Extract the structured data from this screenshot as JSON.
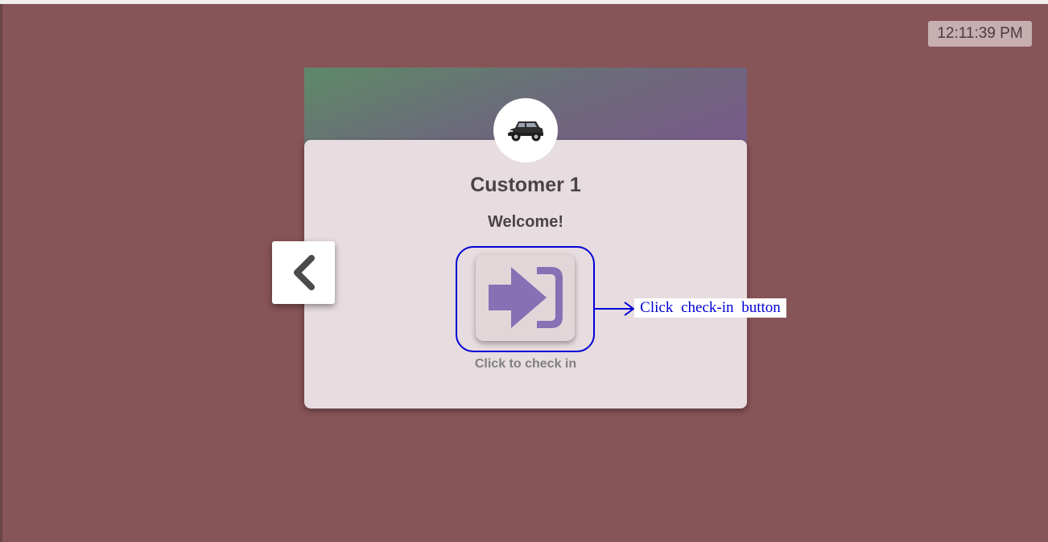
{
  "clock": {
    "time": "12:11:39 PM"
  },
  "customer": {
    "name": "Customer 1",
    "greeting": "Welcome!",
    "avatar_icon": "suv-car-icon"
  },
  "checkin": {
    "icon": "sign-in-arrow-icon",
    "caption": "Click to check in"
  },
  "navigation": {
    "prev_icon": "chevron-left-icon"
  },
  "annotation": {
    "label": "Click check-in button"
  },
  "colors": {
    "background": "#875457",
    "card": "#e7dcdf",
    "accent_icon": "#8770b4",
    "annotation": "#0000d6"
  }
}
